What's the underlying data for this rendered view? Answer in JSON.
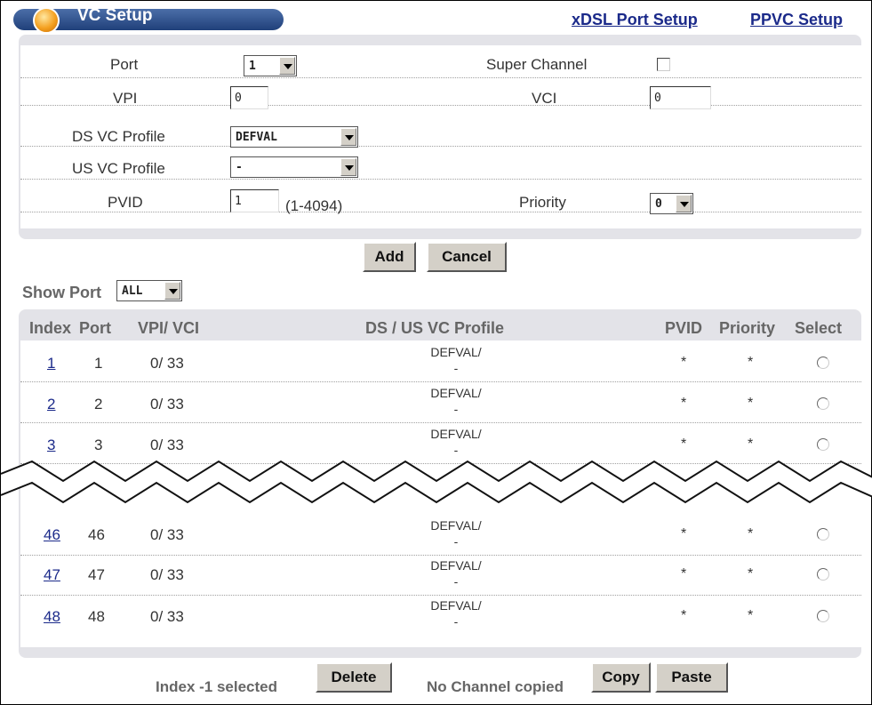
{
  "header": {
    "title": "VC Setup",
    "links": [
      "xDSL Port Setup",
      "PPVC Setup"
    ]
  },
  "form": {
    "port": {
      "label": "Port",
      "value": "1"
    },
    "super_channel": {
      "label": "Super Channel",
      "checked": false
    },
    "vpi": {
      "label": "VPI",
      "value": "0"
    },
    "vci": {
      "label": "VCI",
      "value": "0"
    },
    "ds_vc_profile": {
      "label": "DS VC Profile",
      "value": "DEFVAL"
    },
    "us_vc_profile": {
      "label": "US VC Profile",
      "value": "-"
    },
    "pvid": {
      "label": "PVID",
      "value": "1",
      "hint": "(1-4094)"
    },
    "priority": {
      "label": "Priority",
      "value": "0"
    }
  },
  "actions": {
    "add": "Add",
    "cancel": "Cancel"
  },
  "filter": {
    "label": "Show Port",
    "value": "ALL"
  },
  "table": {
    "columns": [
      "Index",
      "Port",
      "VPI/ VCI",
      "DS / US VC Profile",
      "PVID",
      "Priority",
      "Select"
    ],
    "rows": [
      {
        "index": "1",
        "port": "1",
        "vpi_vci": "0/ 33",
        "ds": "DEFVAL/",
        "us": "-",
        "pvid": "*",
        "priority": "*"
      },
      {
        "index": "2",
        "port": "2",
        "vpi_vci": "0/ 33",
        "ds": "DEFVAL/",
        "us": "-",
        "pvid": "*",
        "priority": "*"
      },
      {
        "index": "3",
        "port": "3",
        "vpi_vci": "0/ 33",
        "ds": "DEFVAL/",
        "us": "-",
        "pvid": "*",
        "priority": "*"
      },
      {
        "index": "46",
        "port": "46",
        "vpi_vci": "0/ 33",
        "ds": "DEFVAL/",
        "us": "-",
        "pvid": "*",
        "priority": "*"
      },
      {
        "index": "47",
        "port": "47",
        "vpi_vci": "0/ 33",
        "ds": "DEFVAL/",
        "us": "-",
        "pvid": "*",
        "priority": "*"
      },
      {
        "index": "48",
        "port": "48",
        "vpi_vci": "0/ 33",
        "ds": "DEFVAL/",
        "us": "-",
        "pvid": "*",
        "priority": "*"
      }
    ]
  },
  "footer": {
    "selected_text": "Index -1 selected",
    "delete": "Delete",
    "copied_text": "No Channel copied",
    "copy": "Copy",
    "paste": "Paste"
  }
}
